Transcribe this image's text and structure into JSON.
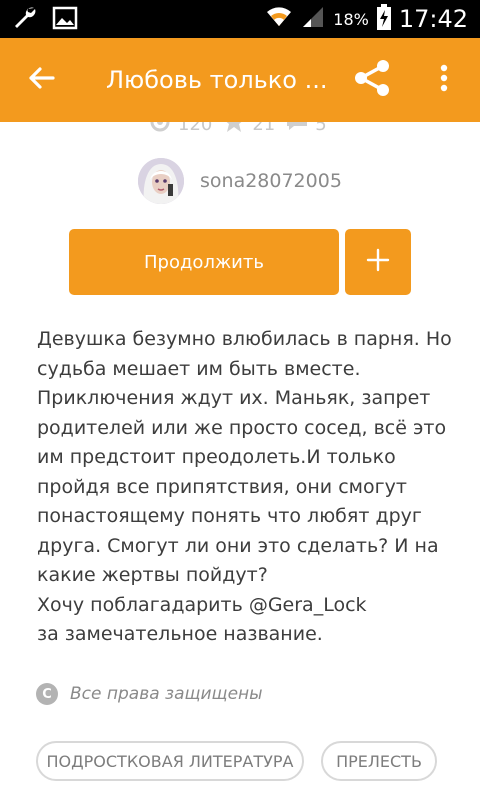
{
  "status_bar": {
    "battery": "18%",
    "time": "17:42"
  },
  "app_bar": {
    "title": "Любовь только ..."
  },
  "stats": {
    "views": "120",
    "votes": "21",
    "comments": "5"
  },
  "author": {
    "username": "sona28072005"
  },
  "actions": {
    "continue_label": "Продолжить",
    "add_label": "+"
  },
  "description": "Девушка безумно влюбилась в парня. Но\nсудьба мешает им быть вместе.\nПриключения ждут их. Маньяк, запрет\nродителей или же просто сосед, всё это\nим предстоит преодолеть.И только\nпройдя все припятствия, они смогут\nпонастоящему понять что любят друг\nдруга. Смогут ли они это сделать? И на\nкакие жертвы пойдут?\nХочу поблагадарить @Gera_Lock\nза замечательное название.",
  "copyright": {
    "icon_letter": "C",
    "text": "Все права защищены"
  },
  "tags": [
    {
      "label": "ПОДРОСТКОВАЯ ЛИТЕРАТУРА"
    },
    {
      "label": "ПРЕЛЕСТЬ"
    }
  ],
  "colors": {
    "accent": "#f39a1e",
    "status_bar": "#000000",
    "text": "#3d3d3d",
    "muted": "#8a8a8a"
  },
  "icons": {
    "status_left": [
      "wrench-icon",
      "image-icon"
    ],
    "status_right": [
      "wifi-icon",
      "signal-icon",
      "battery-charging-icon"
    ],
    "app_bar": [
      "arrow-back-icon",
      "share-icon",
      "more-vert-icon"
    ],
    "stats": [
      "eye-icon",
      "star-icon",
      "comment-icon"
    ]
  }
}
